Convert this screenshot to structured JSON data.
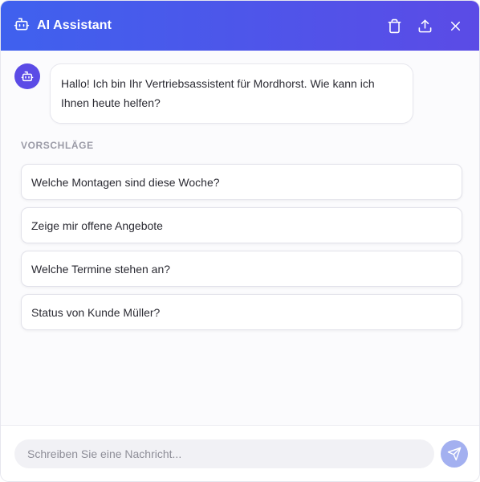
{
  "header": {
    "title": "AI Assistant",
    "icon": "bot-icon",
    "actions": [
      "trash-icon",
      "export-icon",
      "close-icon"
    ],
    "gradient": [
      "#3f61ee",
      "#5b4be6"
    ]
  },
  "conversation": {
    "messages": [
      {
        "sender": "bot",
        "text": "Hallo! Ich bin Ihr Vertriebsassistent für Mordhorst. Wie kann ich Ihnen heute helfen?"
      }
    ]
  },
  "suggestions": {
    "label": "VORSCHLÄGE",
    "items": [
      "Welche Montagen sind diese Woche?",
      "Zeige mir offene Angebote",
      "Welche Termine stehen an?",
      "Status von Kunde Müller?"
    ]
  },
  "composer": {
    "placeholder": "Schreiben Sie eine Nachricht...",
    "value": "",
    "send_icon": "send-icon",
    "send_color": "#a3b0f0"
  }
}
